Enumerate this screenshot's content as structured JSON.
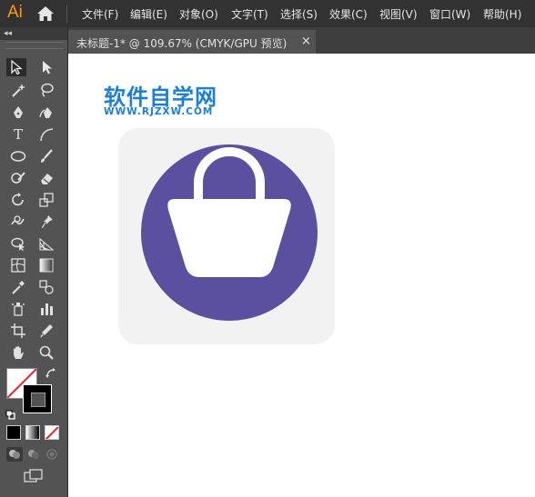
{
  "app": {
    "logo_text": "Ai"
  },
  "menu": {
    "items": [
      {
        "label": "文件(F)"
      },
      {
        "label": "编辑(E)"
      },
      {
        "label": "对象(O)"
      },
      {
        "label": "文字(T)"
      },
      {
        "label": "选择(S)"
      },
      {
        "label": "效果(C)"
      },
      {
        "label": "视图(V)"
      },
      {
        "label": "窗口(W)"
      },
      {
        "label": "帮助(H)"
      }
    ]
  },
  "toolbar": {
    "collapse_label": "◂◂",
    "type_tool_glyph": "T"
  },
  "document": {
    "tab_title": "未标题-1* @ 109.67% (CMYK/GPU 预览)",
    "close_glyph": "×"
  },
  "watermark": {
    "title": "软件自学网",
    "url": "WWW.RJZXW.COM",
    "color": "#1b7fd8"
  },
  "artwork": {
    "background_color": "#f2f2f2",
    "circle_color": "#5b4f9f",
    "bag_color": "#ffffff",
    "icon": "shopping-bag-icon"
  },
  "colors": {
    "app_accent": "#ff9a00",
    "menubar_bg": "#323232",
    "panel_bg": "#535353"
  }
}
